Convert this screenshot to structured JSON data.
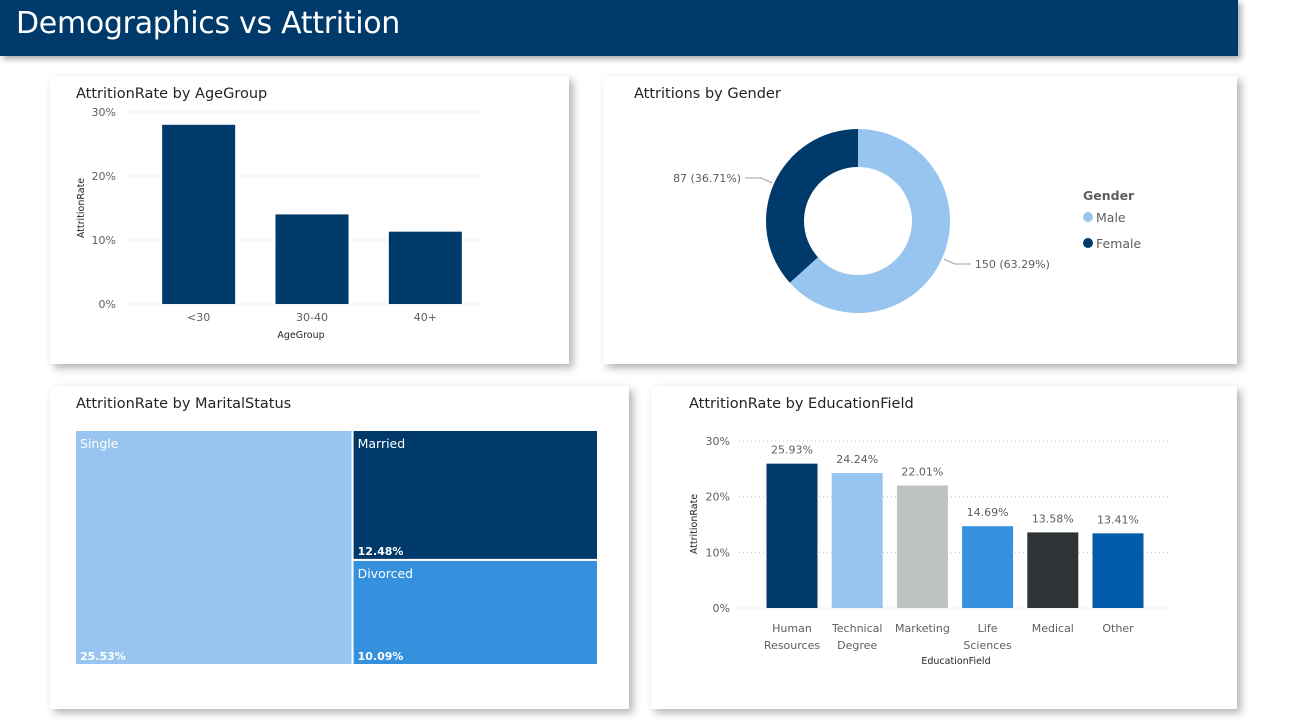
{
  "page": {
    "title": "Demographics vs Attrition"
  },
  "charts": {
    "age": {
      "title": "AttritionRate by AgeGroup",
      "color": "#003A6B"
    },
    "gender": {
      "title": "Attritions by Gender",
      "legend_title": "Gender",
      "colors": {
        "Male": "#97C5EF",
        "Female": "#003A6B"
      },
      "labels": [
        "150 (63.29%)",
        "87 (36.71%)"
      ]
    },
    "marital": {
      "title": "AttritionRate by MaritalStatus",
      "colors": {
        "Single": "#97C5EF",
        "Married": "#003A6B",
        "Divorced": "#3590DE"
      },
      "value_labels": [
        "25.53%",
        "12.48%",
        "10.09%"
      ]
    },
    "education": {
      "title": "AttritionRate by EducationField",
      "colors": [
        "#003A6B",
        "#97C5EF",
        "#BEC3C2",
        "#3590DE",
        "#2E3336",
        "#005CA8"
      ],
      "value_labels": [
        "25.93%",
        "24.24%",
        "22.01%",
        "14.69%",
        "13.58%",
        "13.41%"
      ]
    }
  },
  "chart_data": [
    {
      "type": "bar",
      "title": "AttritionRate by AgeGroup",
      "categories": [
        "<30",
        "30-40",
        "40+"
      ],
      "values": [
        28.0,
        14.0,
        11.3
      ],
      "xlabel": "AgeGroup",
      "ylabel": "AttritionRate",
      "yticks": [
        "0%",
        "10%",
        "20%",
        "30%"
      ],
      "ylim": [
        0,
        30
      ],
      "grid": true
    },
    {
      "type": "pie",
      "title": "Attritions by Gender",
      "categories": [
        "Male",
        "Female"
      ],
      "values": [
        150,
        87
      ],
      "percents": [
        63.29,
        36.71
      ],
      "legend_title": "Gender",
      "legend_position": "right"
    },
    {
      "type": "treemap",
      "title": "AttritionRate by MaritalStatus",
      "categories": [
        "Single",
        "Married",
        "Divorced"
      ],
      "values": [
        25.53,
        12.48,
        10.09
      ]
    },
    {
      "type": "bar",
      "title": "AttritionRate by EducationField",
      "categories": [
        "Human Resources",
        "Technical Degree",
        "Marketing",
        "Life Sciences",
        "Medical",
        "Other"
      ],
      "tick_lines": [
        [
          "Human",
          "Resources"
        ],
        [
          "Technical",
          "Degree"
        ],
        [
          "Marketing"
        ],
        [
          "Life",
          "Sciences"
        ],
        [
          "Medical"
        ],
        [
          "Other"
        ]
      ],
      "values": [
        25.93,
        24.24,
        22.01,
        14.69,
        13.58,
        13.41
      ],
      "xlabel": "EducationField",
      "ylabel": "AttritionRate",
      "yticks": [
        "0%",
        "10%",
        "20%",
        "30%"
      ],
      "ylim": [
        0,
        30
      ],
      "grid": true
    }
  ]
}
